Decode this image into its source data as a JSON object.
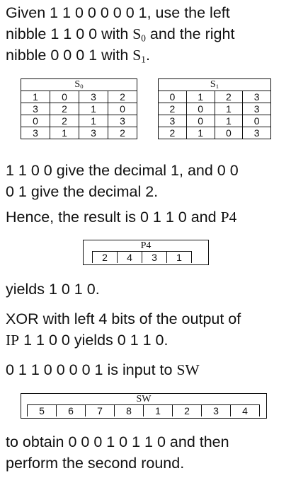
{
  "para1": {
    "a": "Given 1 1 0 0 0 0 0 1, use the left",
    "b": "nibble 1 1 0 0 with ",
    "s0": "S",
    "s0sub": "0",
    "c": " and the right",
    "d": "nibble 0 0 0 1 with ",
    "s1": "S",
    "s1sub": "1",
    "e": "."
  },
  "s0_table": {
    "title": "S",
    "title_sub": "0",
    "rows": [
      [
        "1",
        "0",
        "3",
        "2"
      ],
      [
        "3",
        "2",
        "1",
        "0"
      ],
      [
        "0",
        "2",
        "1",
        "3"
      ],
      [
        "3",
        "1",
        "3",
        "2"
      ]
    ]
  },
  "s1_table": {
    "title": "S",
    "title_sub": "1",
    "rows": [
      [
        "0",
        "1",
        "2",
        "3"
      ],
      [
        "2",
        "0",
        "1",
        "3"
      ],
      [
        "3",
        "0",
        "1",
        "0"
      ],
      [
        "2",
        "1",
        "0",
        "3"
      ]
    ]
  },
  "para2": {
    "a": "1 1 0 0 give the decimal 1, and 0 0",
    "b": "0 1 give the decimal 2."
  },
  "para3": {
    "a": "Hence, the result is 0 1 1 0 and ",
    "p4": "P4"
  },
  "p4_box": {
    "title": "P4",
    "cells": [
      "2",
      "4",
      "3",
      "1"
    ]
  },
  "para4": "yields 1 0 1 0.",
  "para5": {
    "a": "XOR with left 4 bits of the output of",
    "ip": "IP",
    "b": " 1 1 0 0 yields 0 1 1 0."
  },
  "para6": {
    "a": "0 1 1 0 0 0 0 1 is input to ",
    "sw": "SW"
  },
  "sw_box": {
    "title": "SW",
    "cells": [
      "5",
      "6",
      "7",
      "8",
      "1",
      "2",
      "3",
      "4"
    ]
  },
  "para7": {
    "a": "to obtain 0 0 0 1 0 1 1 0 and then",
    "b": "perform the second round."
  }
}
